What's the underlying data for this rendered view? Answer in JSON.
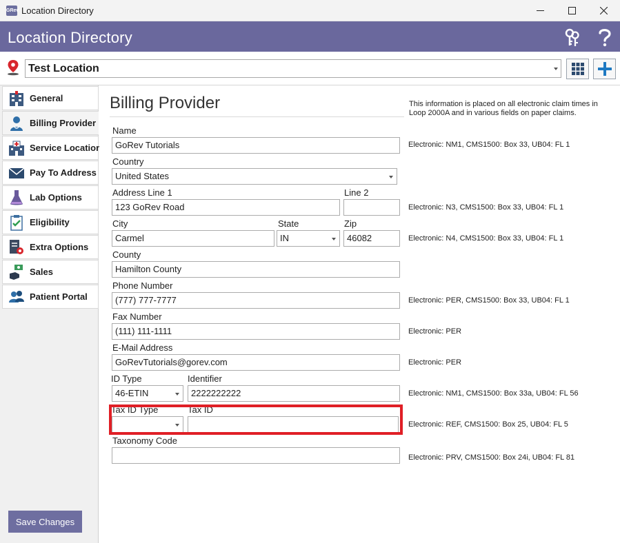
{
  "window": {
    "title": "Location Directory",
    "app_icon_text": "GRev",
    "controls": [
      "minimize",
      "maximize",
      "close"
    ]
  },
  "header": {
    "title": "Location Directory",
    "icons": [
      "keys-icon",
      "help-icon"
    ],
    "bg_color": "#6a689d"
  },
  "location": {
    "selected": "Test Location",
    "icons": [
      "map-pin-icon",
      "grid-icon",
      "plus-icon"
    ]
  },
  "nav": {
    "items": [
      {
        "label": "General",
        "icon": "building-icon"
      },
      {
        "label": "Billing Provider",
        "icon": "doctor-icon",
        "active": true
      },
      {
        "label": "Service Location",
        "icon": "hospital-icon"
      },
      {
        "label": "Pay To Address",
        "icon": "envelope-icon"
      },
      {
        "label": "Lab Options",
        "icon": "flask-icon"
      },
      {
        "label": "Eligibility",
        "icon": "clipboard-check-icon"
      },
      {
        "label": "Extra Options",
        "icon": "gear-document-icon"
      },
      {
        "label": "Sales",
        "icon": "money-icon"
      },
      {
        "label": "Patient Portal",
        "icon": "users-icon"
      }
    ],
    "save_label": "Save Changes"
  },
  "form": {
    "title": "Billing Provider",
    "note": "This information is placed on all electronic claim times in Loop 2000A and in various fields on paper claims.",
    "name_label": "Name",
    "name_value": "GoRev Tutorials",
    "country_label": "Country",
    "country_value": "United States",
    "addr1_label": "Address Line 1",
    "addr1_value": "123 GoRev Road",
    "line2_label": "Line 2",
    "line2_value": "",
    "city_label": "City",
    "city_value": "Carmel",
    "state_label": "State",
    "state_value": "IN",
    "zip_label": "Zip",
    "zip_value": "46082",
    "county_label": "County",
    "county_value": "Hamilton County",
    "phone_label": "Phone Number",
    "phone_value": "(777) 777-7777",
    "fax_label": "Fax Number",
    "fax_value": "(111) 111-1111",
    "email_label": "E-Mail Address",
    "email_value": "GoRevTutorials@gorev.com",
    "idtype_label": "ID Type",
    "idtype_value": "46-ETIN",
    "identifier_label": "Identifier",
    "identifier_value": "2222222222",
    "taxidtype_label": "Tax ID Type",
    "taxidtype_value": "",
    "taxid_label": "Tax ID",
    "taxid_value": "",
    "taxonomy_label": "Taxonomy Code",
    "taxonomy_value": ""
  },
  "electronic": {
    "name": "Electronic: NM1, CMS1500: Box 33, UB04: FL 1",
    "address": "Electronic: N3, CMS1500: Box 33, UB04: FL 1",
    "city": "Electronic: N4, CMS1500: Box 33, UB04: FL 1",
    "phone": "Electronic: PER, CMS1500: Box 33, UB04: FL 1",
    "fax": "Electronic: PER",
    "email": "Electronic: PER",
    "identifier": "Electronic: NM1, CMS1500: Box 33a, UB04: FL 56",
    "taxid": "Electronic: REF, CMS1500: Box 25, UB04: FL 5",
    "taxonomy": "Electronic: PRV, CMS1500: Box 24i, UB04: FL 81"
  },
  "colors": {
    "accent": "#6a689d",
    "highlight": "#e01f26",
    "save_button": "#6e6ea0"
  }
}
